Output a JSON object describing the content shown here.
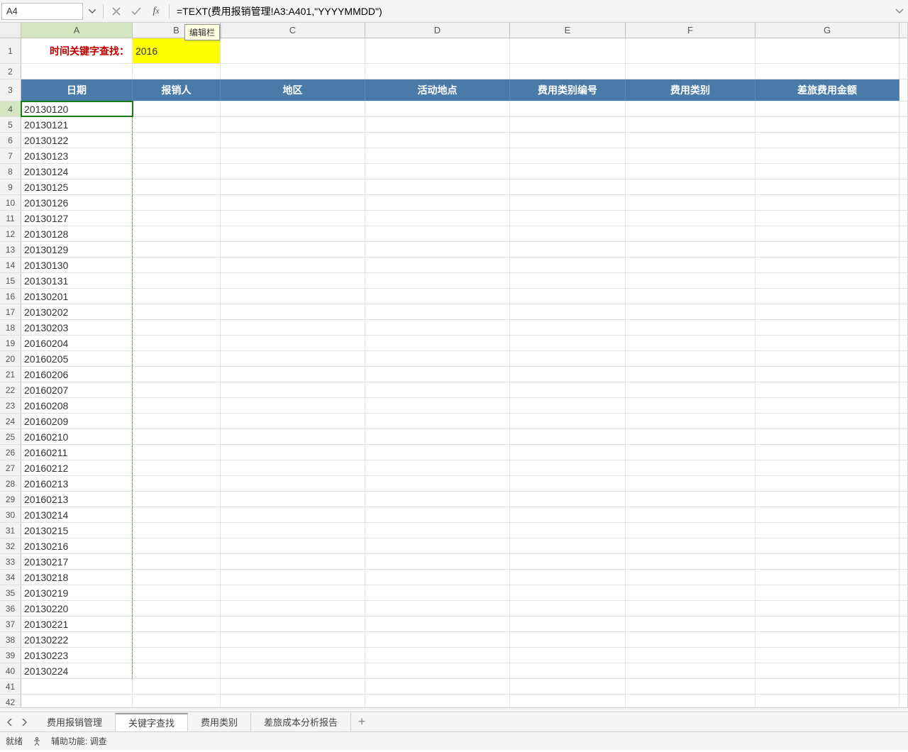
{
  "namebox": "A4",
  "formula": "=TEXT(费用报销管理!A3:A401,\"YYYYMMDD\")",
  "tooltip": "编辑栏",
  "columns": [
    "A",
    "B",
    "C",
    "D",
    "E",
    "F",
    "G"
  ],
  "row1": {
    "label": "时间关键字查找：",
    "searchValue": "2016"
  },
  "headers": [
    "日期",
    "报销人",
    "地区",
    "活动地点",
    "费用类别编号",
    "费用类别",
    "差旅费用金额"
  ],
  "dates": [
    "20130120",
    "20130121",
    "20130122",
    "20130123",
    "20130124",
    "20130125",
    "20130126",
    "20130127",
    "20130128",
    "20130129",
    "20130130",
    "20130131",
    "20130201",
    "20130202",
    "20130203",
    "20160204",
    "20160205",
    "20160206",
    "20160207",
    "20160208",
    "20160209",
    "20160210",
    "20160211",
    "20160212",
    "20160213",
    "20160213",
    "20130214",
    "20130215",
    "20130216",
    "20130217",
    "20130218",
    "20130219",
    "20130220",
    "20130221",
    "20130222",
    "20130223",
    "20130224"
  ],
  "sheets": [
    {
      "name": "费用报销管理",
      "active": false
    },
    {
      "name": "关键字查找",
      "active": true
    },
    {
      "name": "费用类别",
      "active": false
    },
    {
      "name": "差旅成本分析报告",
      "active": false
    }
  ],
  "status": {
    "ready": "就绪",
    "accessibility": "辅助功能: 调查"
  }
}
